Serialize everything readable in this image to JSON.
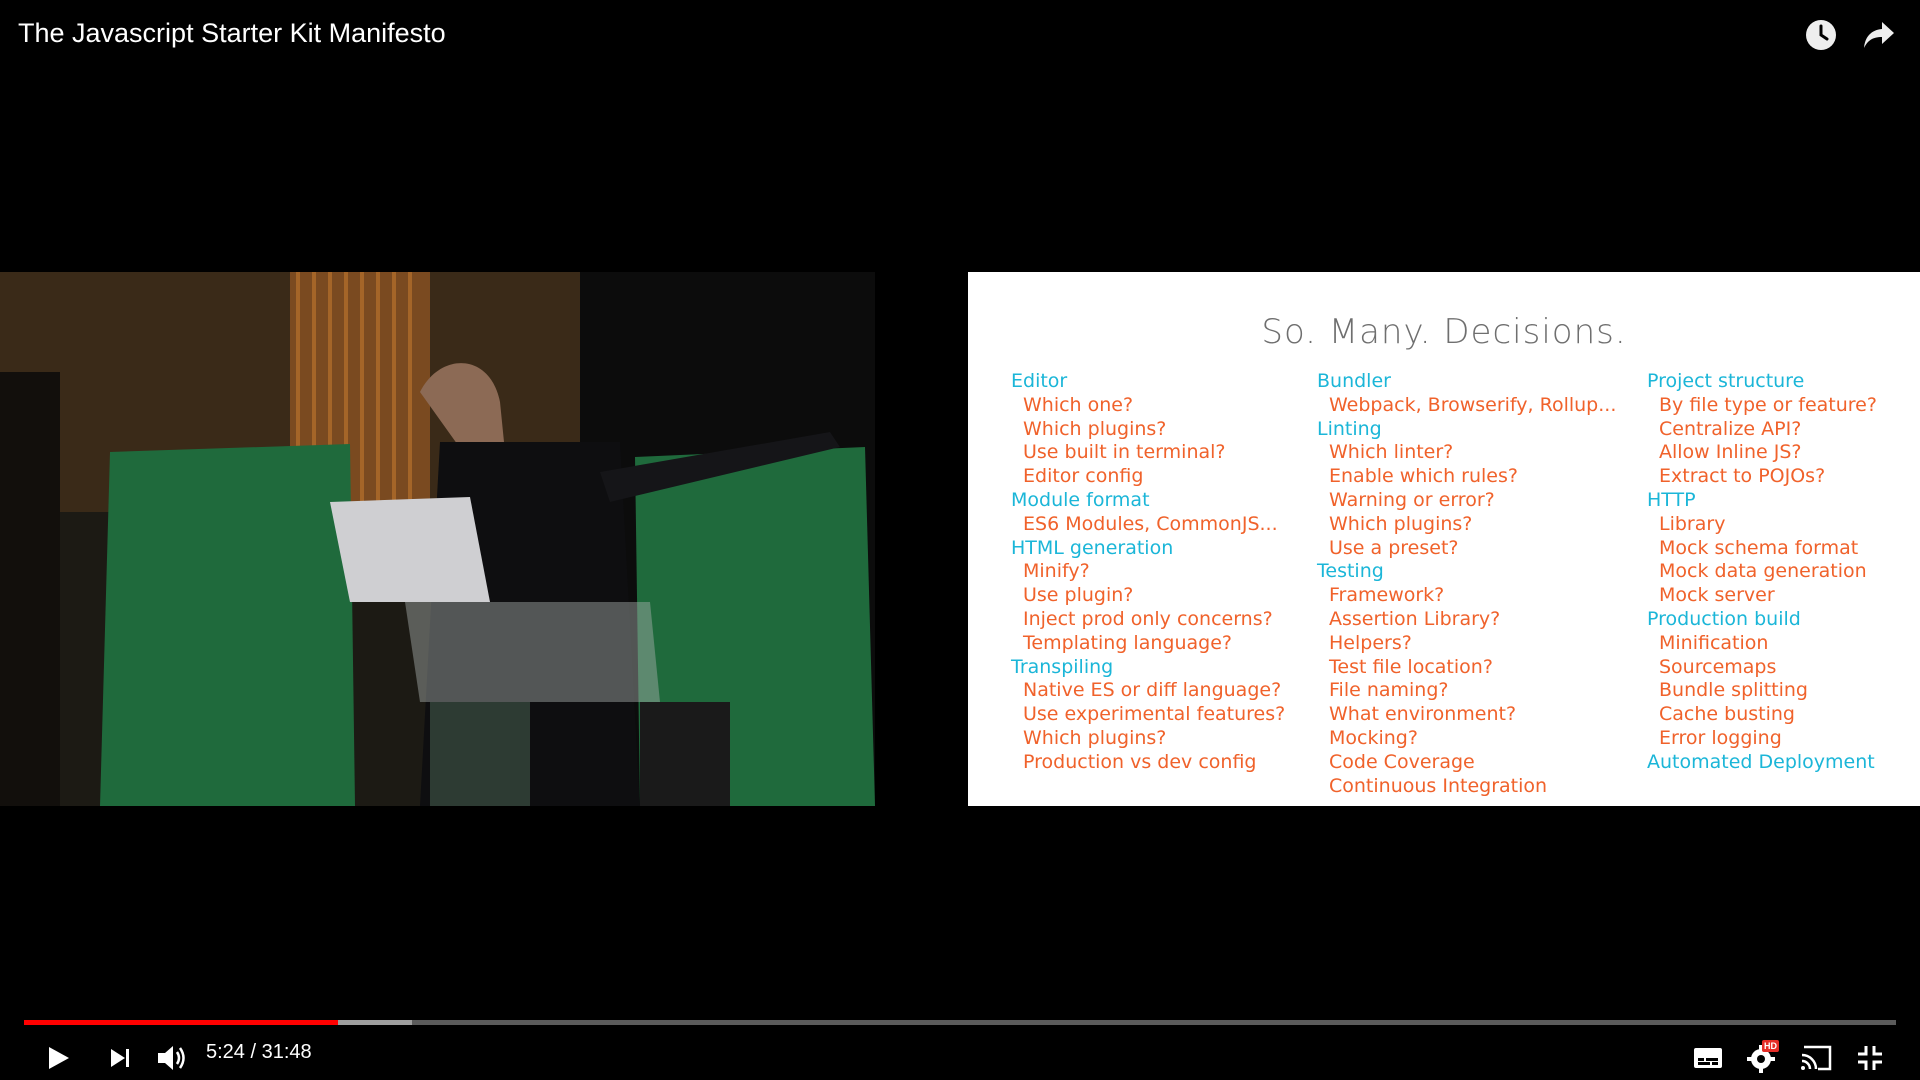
{
  "player": {
    "title": "The Javascript Starter Kit Manifesto",
    "time_current": "5:24",
    "time_separator": " / ",
    "time_total": "31:48",
    "progress_played": 0.168,
    "progress_buffered": 0.207,
    "colors": {
      "played": "#ff0000",
      "buffered": "#9e9e9e",
      "track": "#5b5b5b"
    }
  },
  "icons": {
    "watch_later": "clock-icon",
    "share": "share-icon",
    "play": "play-icon",
    "next": "next-icon",
    "volume": "volume-icon",
    "captions": "captions-icon",
    "settings": "gear-icon",
    "quality_badge": "HD",
    "cast": "cast-icon",
    "exit_fullscreen": "exit-fullscreen-icon"
  },
  "slide": {
    "title": "So. Many. Decisions.",
    "columns": [
      [
        {
          "head": "Editor"
        },
        {
          "item": "Which one?"
        },
        {
          "item": "Which plugins?"
        },
        {
          "item": "Use built in terminal?"
        },
        {
          "item": "Editor config"
        },
        {
          "head": "Module format"
        },
        {
          "item": "ES6 Modules, CommonJS..."
        },
        {
          "head": "HTML generation"
        },
        {
          "item": "Minify?"
        },
        {
          "item": "Use plugin?"
        },
        {
          "item": "Inject prod only concerns?"
        },
        {
          "item": "Templating language?"
        },
        {
          "head": "Transpiling"
        },
        {
          "item": "Native ES or diff language?"
        },
        {
          "item": "Use experimental features?"
        },
        {
          "item": "Which plugins?"
        },
        {
          "item": "Production vs dev config"
        }
      ],
      [
        {
          "head": "Bundler"
        },
        {
          "item": "Webpack, Browserify, Rollup..."
        },
        {
          "head": "Linting"
        },
        {
          "item": "Which linter?"
        },
        {
          "item": "Enable which rules?"
        },
        {
          "item": "Warning or error?"
        },
        {
          "item": "Which plugins?"
        },
        {
          "item": "Use a preset?"
        },
        {
          "head": "Testing"
        },
        {
          "item": "Framework?"
        },
        {
          "item": "Assertion Library?"
        },
        {
          "item": "Helpers?"
        },
        {
          "item": "Test file location?"
        },
        {
          "item": "File naming?"
        },
        {
          "item": "What environment?"
        },
        {
          "item": "Mocking?"
        },
        {
          "item": "Code Coverage"
        },
        {
          "item": "Continuous Integration"
        }
      ],
      [
        {
          "head": "Project structure"
        },
        {
          "item": "By file type or feature?"
        },
        {
          "item": "Centralize API?"
        },
        {
          "item": "Allow Inline JS?"
        },
        {
          "item": "Extract to POJOs?"
        },
        {
          "head": "HTTP"
        },
        {
          "item": "Library"
        },
        {
          "item": "Mock schema format"
        },
        {
          "item": "Mock data generation"
        },
        {
          "item": "Mock server"
        },
        {
          "head": "Production build"
        },
        {
          "item": "Minification"
        },
        {
          "item": "Sourcemaps"
        },
        {
          "item": "Bundle splitting"
        },
        {
          "item": "Cache busting"
        },
        {
          "item": "Error logging"
        },
        {
          "head": "Automated Deployment"
        }
      ]
    ]
  }
}
